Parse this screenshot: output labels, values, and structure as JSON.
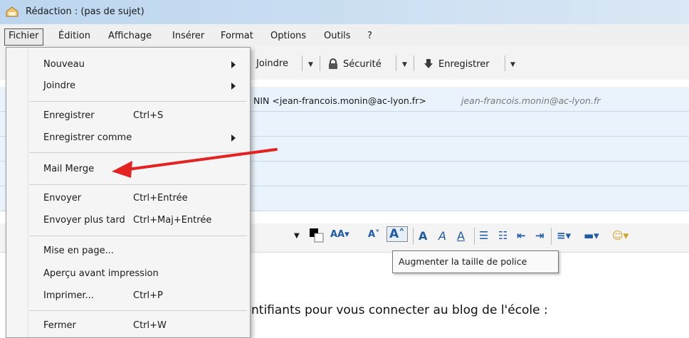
{
  "window": {
    "title": "Rédaction : (pas de sujet)"
  },
  "menubar": {
    "items": [
      "Fichier",
      "Édition",
      "Affichage",
      "Insérer",
      "Format",
      "Options",
      "Outils",
      "?"
    ]
  },
  "toolbar": {
    "attach_label": "Joindre",
    "security_label": "Sécurité",
    "save_label": "Enregistrer"
  },
  "header": {
    "from_text": "NIN <jean-francois.monin@ac-lyon.fr>",
    "from_identity": "jean-francois.monin@ac-lyon.fr"
  },
  "file_menu": {
    "items": [
      {
        "label": "Nouveau",
        "shortcut": "",
        "submenu": true
      },
      {
        "label": "Joindre",
        "shortcut": "",
        "submenu": true
      },
      {
        "label": "Enregistrer",
        "shortcut": "Ctrl+S",
        "submenu": false
      },
      {
        "label": "Enregistrer comme",
        "shortcut": "",
        "submenu": true
      },
      {
        "label": "Mail Merge",
        "shortcut": "",
        "submenu": false
      },
      {
        "label": "Envoyer",
        "shortcut": "Ctrl+Entrée",
        "submenu": false
      },
      {
        "label": "Envoyer plus tard",
        "shortcut": "Ctrl+Maj+Entrée",
        "submenu": false
      },
      {
        "label": "Mise en page...",
        "shortcut": "",
        "submenu": false
      },
      {
        "label": "Aperçu avant impression",
        "shortcut": "",
        "submenu": false
      },
      {
        "label": "Imprimer...",
        "shortcut": "Ctrl+P",
        "submenu": false
      },
      {
        "label": "Fermer",
        "shortcut": "Ctrl+W",
        "submenu": false
      }
    ]
  },
  "format_toolbar": {
    "tooltip": "Augmenter la taille de police"
  },
  "body": {
    "text": "ntifiants pour vous connecter au blog de l'école :"
  },
  "colors": {
    "annotation_arrow": "#e32222",
    "format_icons": "#1f5aa8"
  }
}
